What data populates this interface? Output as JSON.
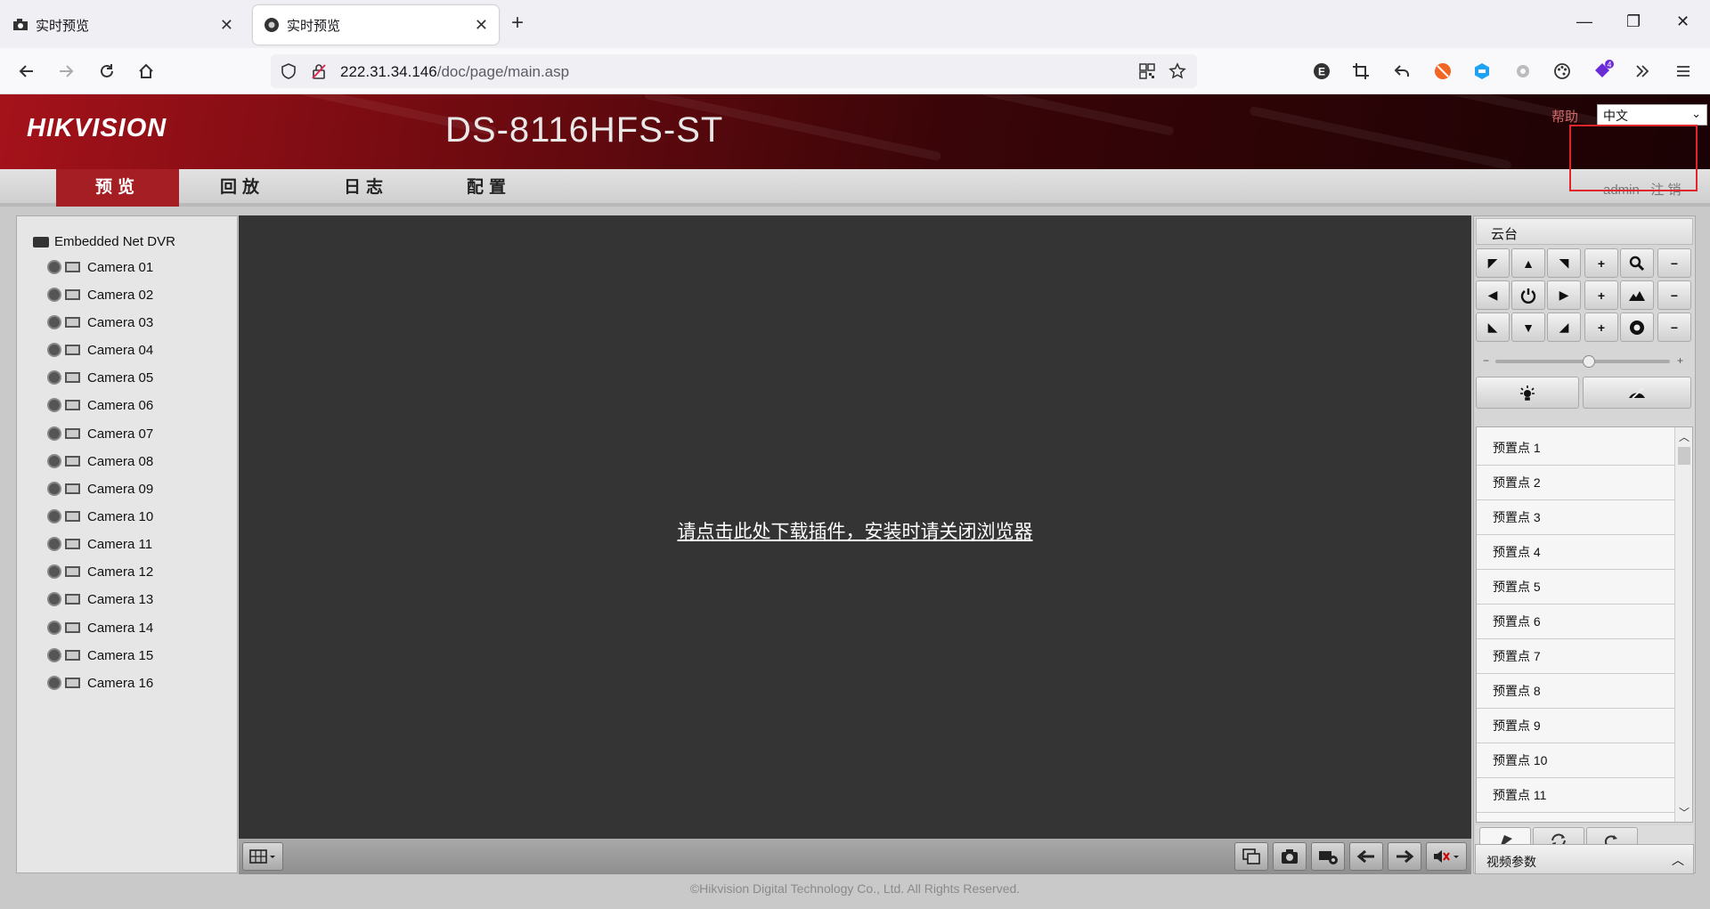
{
  "browser": {
    "tabs": [
      {
        "title": "实时预览",
        "active": false
      },
      {
        "title": "实时预览",
        "active": true
      }
    ],
    "url_host": "222.31.34.146",
    "url_path": "/doc/page/main.asp"
  },
  "header": {
    "logo": "HIKVISION",
    "model": "DS-8116HFS-ST",
    "help": "帮助",
    "language": "中文"
  },
  "menu": {
    "items": [
      "预览",
      "回放",
      "日志",
      "配置"
    ],
    "active_index": 0,
    "user": "admin",
    "logout": "注 销"
  },
  "tree": {
    "root": "Embedded Net DVR",
    "cameras": [
      "Camera 01",
      "Camera 02",
      "Camera 03",
      "Camera 04",
      "Camera 05",
      "Camera 06",
      "Camera 07",
      "Camera 08",
      "Camera 09",
      "Camera 10",
      "Camera 11",
      "Camera 12",
      "Camera 13",
      "Camera 14",
      "Camera 15",
      "Camera 16"
    ]
  },
  "video": {
    "plugin_link": "请点击此处下载插件，安装时请关闭浏览器"
  },
  "ptz": {
    "title": "云台",
    "presets": [
      "预置点 1",
      "预置点 2",
      "预置点 3",
      "预置点 4",
      "预置点 5",
      "预置点 6",
      "预置点 7",
      "预置点 8",
      "预置点 9",
      "预置点 10",
      "预置点 11"
    ],
    "video_params": "视频参数"
  },
  "footer": "©Hikvision Digital Technology Co., Ltd. All Rights Reserved.",
  "colors": {
    "accent": "#a41e24",
    "highlight_box": "#e0262b",
    "video_bg": "#343434"
  }
}
